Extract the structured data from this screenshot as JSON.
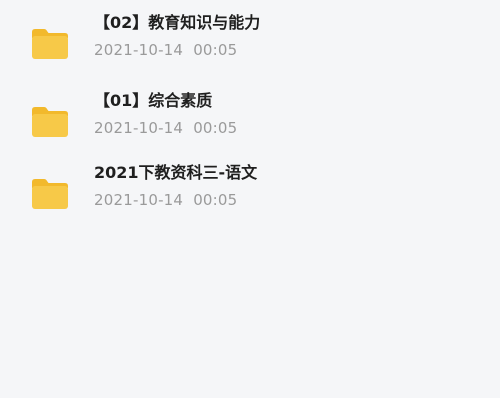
{
  "files": [
    {
      "name": "【02】教育知识与能力",
      "date": "2021-10-14",
      "time": "00:05",
      "icon": "folder-icon"
    },
    {
      "name": "【01】综合素质",
      "date": "2021-10-14",
      "time": "00:05",
      "icon": "folder-icon"
    },
    {
      "name": "2021下教资科三-语文",
      "date": "2021-10-14",
      "time": "00:05",
      "icon": "folder-icon"
    }
  ],
  "colors": {
    "background": "#f5f6f8",
    "folder_body": "#f7c948",
    "folder_tab": "#f2b92c",
    "name_text": "#1f1f1f",
    "date_text": "#9a9a9a"
  }
}
